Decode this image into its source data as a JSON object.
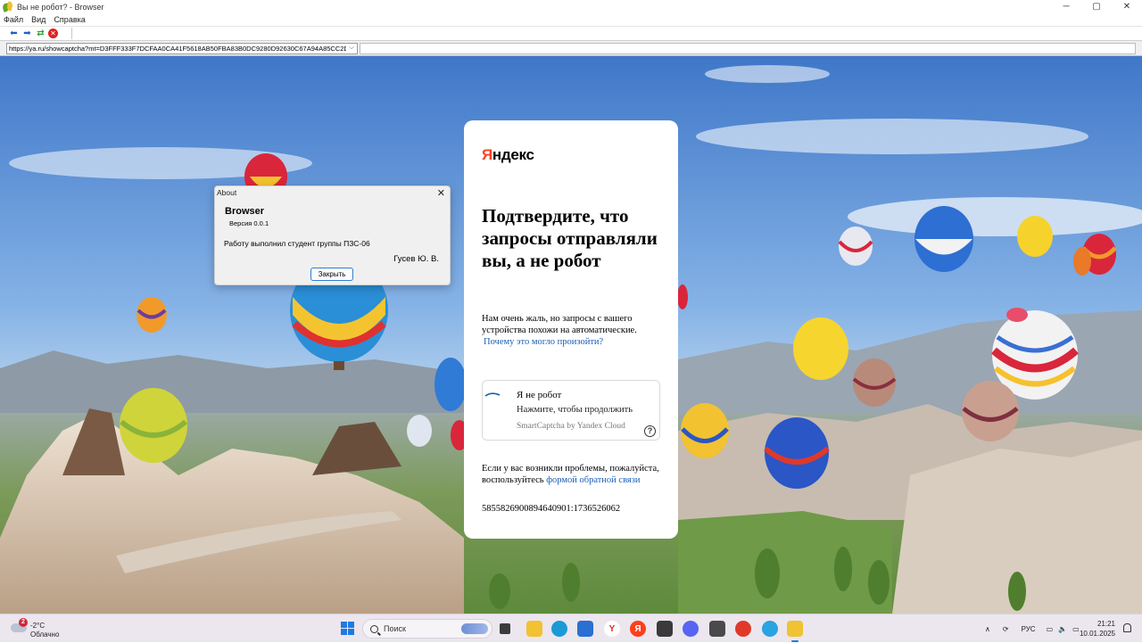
{
  "window": {
    "title": "Вы не робот? - Browser",
    "controls": {
      "minimize": "─",
      "maximize": "▢",
      "close": "✕"
    }
  },
  "menu": [
    "Файл",
    "Вид",
    "Справка"
  ],
  "toolbar": {
    "back_icon": "arrow-left-icon",
    "forward_icon": "arrow-right-icon",
    "refresh_icon": "refresh-icon",
    "stop_icon": "stop-icon"
  },
  "address": {
    "url": "https://ya.ru/showcaptcha?mt=D3FFF333F7DCFAA0CA41F5618AB50FBA83B0DC9280D92630C67A94A85CC2D90E3",
    "dropdown": "⌵"
  },
  "captcha": {
    "logo_first": "Я",
    "logo_rest": "ндекс",
    "heading": "Подтвердите, что запросы отправляли вы, а не робот",
    "body": "Нам очень жаль, но запросы с вашего устройства похожи на автоматические.",
    "why_link": "Почему это могло произойти?",
    "checkbox_title": "Я не робот",
    "checkbox_sub": "Нажмите, чтобы продолжить",
    "checkbox_brand": "SmartCaptcha by Yandex Cloud",
    "help": "?",
    "problem_text": "Если у вас возникли проблемы, пожалуйста, воспользуйтесь ",
    "feedback_link": "формой обратной связи",
    "request_id": "5855826900894640901:1736526062"
  },
  "about": {
    "title": "About",
    "close": "✕",
    "app_name": "Browser",
    "version": "Версия 0.0.1",
    "author_line": "Работу выполнил студент  группы ПЗС-06",
    "author_name": "Гусев Ю. В.",
    "ok_button": "Закрыть"
  },
  "taskbar": {
    "weather_badge": "2",
    "weather_temp": "-2°C",
    "weather_desc": "Облачно",
    "search_placeholder": "Поиск",
    "tray_lang": "РУС",
    "tray_chevron": "∧",
    "time": "21:21",
    "date": "10.01.2025"
  },
  "colors": {
    "yandex_red": "#fc3f1d",
    "link_blue": "#1a5fb4",
    "accent_blue": "#1f7ae0"
  }
}
